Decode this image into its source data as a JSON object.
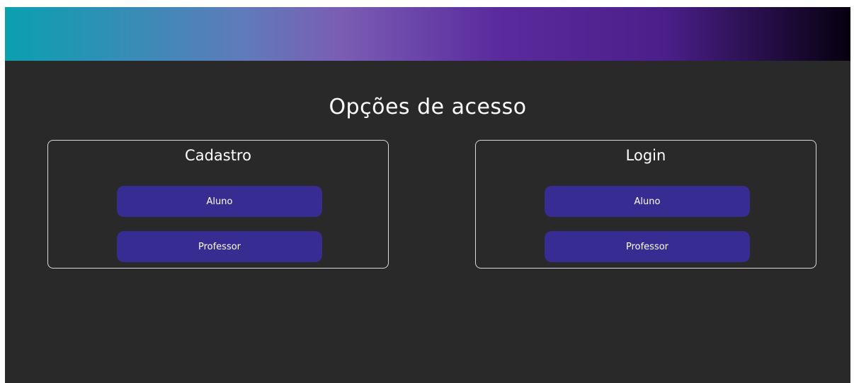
{
  "colors": {
    "page_background": "#292929",
    "button_background": "#372c91",
    "header_gradient": [
      "#0aa0b0",
      "#5f7bbb",
      "#7a5db3",
      "#5a2b9e",
      "#4b1f8a",
      "#06000f"
    ]
  },
  "page": {
    "title": "Opções de acesso"
  },
  "signup": {
    "title": "Cadastro",
    "student_label": "Aluno",
    "teacher_label": "Professor"
  },
  "login": {
    "title": "Login",
    "student_label": "Aluno",
    "teacher_label": "Professor"
  }
}
